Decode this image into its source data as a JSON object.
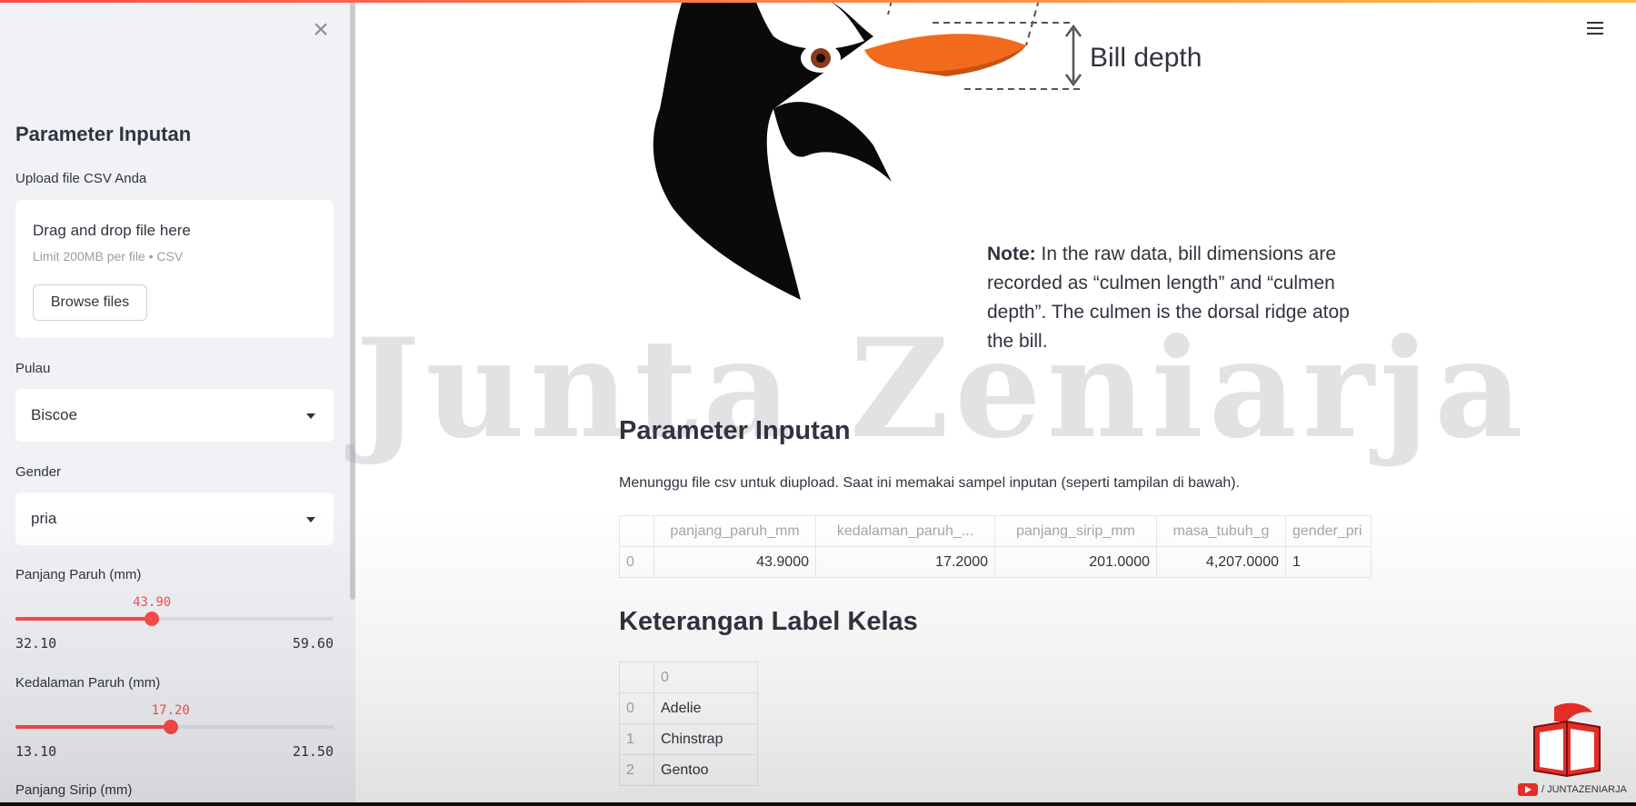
{
  "sidebar": {
    "close_glyph": "×",
    "title": "Parameter Inputan",
    "upload": {
      "label": "Upload file CSV Anda",
      "drag_text": "Drag and drop file here",
      "limit_text": "Limit 200MB per file • CSV",
      "browse_label": "Browse files"
    },
    "pulau": {
      "label": "Pulau",
      "value": "Biscoe"
    },
    "gender": {
      "label": "Gender",
      "value": "pria"
    },
    "panjang_paruh": {
      "label": "Panjang Paruh (mm)",
      "value": "43.90",
      "min": "32.10",
      "max": "59.60",
      "fraction": 0.429
    },
    "kedalaman_paruh": {
      "label": "Kedalaman Paruh (mm)",
      "value": "17.20",
      "min": "13.10",
      "max": "21.50",
      "fraction": 0.488
    },
    "panjang_sirip": {
      "label": "Panjang Sirip (mm)"
    }
  },
  "main": {
    "illustration": {
      "bill_depth_label": "Bill depth"
    },
    "note": {
      "bold": "Note:",
      "text": " In the raw data, bill dimensions are recorded as “culmen length” and “culmen depth”. The culmen is the dorsal ridge atop the bill."
    },
    "watermark": "Junta Zeniarja",
    "section1_title": "Parameter Inputan",
    "section1_desc": "Menunggu file csv untuk diupload. Saat ini memakai sampel inputan (seperti tampilan di bawah).",
    "input_table": {
      "headers": [
        "",
        "panjang_paruh_mm",
        "kedalaman_paruh_...",
        "panjang_sirip_mm",
        "masa_tubuh_g",
        "gender_pri"
      ],
      "row": [
        "0",
        "43.9000",
        "17.2000",
        "201.0000",
        "4,207.0000",
        "1"
      ]
    },
    "section2_title": "Keterangan Label Kelas",
    "label_table": {
      "header": "0",
      "rows": [
        {
          "index": "0",
          "value": "Adelie"
        },
        {
          "index": "1",
          "value": "Chinstrap"
        },
        {
          "index": "2",
          "value": "Gentoo"
        }
      ]
    },
    "channel_text": "/ JUNTAZENIARJA"
  },
  "colors": {
    "accent": "#ff4b4b",
    "sidebar_bg": "#f0f2f6",
    "beak": "#f26a1b"
  }
}
